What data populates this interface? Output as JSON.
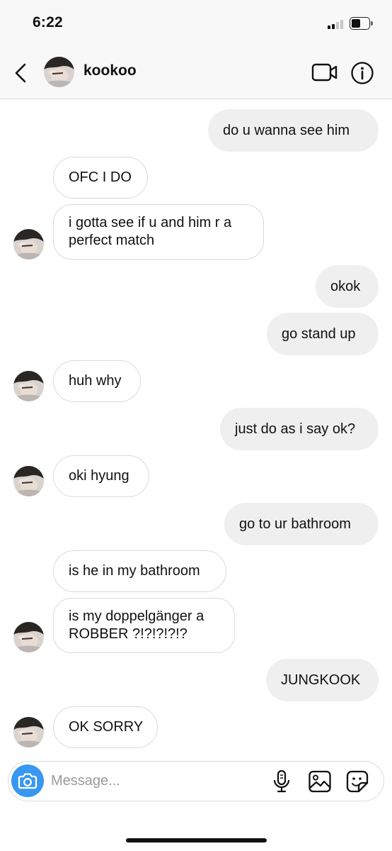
{
  "status_bar": {
    "time": "6:22",
    "signal_bars_filled": 2,
    "signal_bars_total": 4,
    "battery_level": 0.5
  },
  "header": {
    "contact_name": "kookoo",
    "icons": [
      "back-chevron-icon",
      "video-call-icon",
      "info-icon"
    ]
  },
  "messages": [
    {
      "direction": "outgoing",
      "text": "do u wanna see him"
    },
    {
      "direction": "incoming",
      "text": "OFC I DO"
    },
    {
      "direction": "incoming",
      "text": "i gotta see if u and him r a perfect match"
    },
    {
      "direction": "outgoing",
      "text": "okok"
    },
    {
      "direction": "outgoing",
      "text": "go stand up"
    },
    {
      "direction": "incoming",
      "text": "huh why"
    },
    {
      "direction": "outgoing",
      "text": "just do as i say ok?"
    },
    {
      "direction": "incoming",
      "text": "oki hyung"
    },
    {
      "direction": "outgoing",
      "text": "go to ur bathroom"
    },
    {
      "direction": "incoming",
      "text": "is he in my bathroom"
    },
    {
      "direction": "incoming",
      "text": "is my doppelgänger a ROBBER ?!?!?!?!?"
    },
    {
      "direction": "outgoing",
      "text": "JUNGKOOK"
    },
    {
      "direction": "incoming",
      "text": "OK SORRY"
    }
  ],
  "composer": {
    "placeholder": "Message...",
    "value": "",
    "icons": [
      "camera-icon",
      "microphone-icon",
      "gallery-icon",
      "sticker-icon"
    ]
  },
  "colors": {
    "accent": "#3897f0",
    "outgoing_bubble": "#efefef",
    "incoming_border": "#dbdbdb",
    "header_bg": "#f8f8f8"
  }
}
